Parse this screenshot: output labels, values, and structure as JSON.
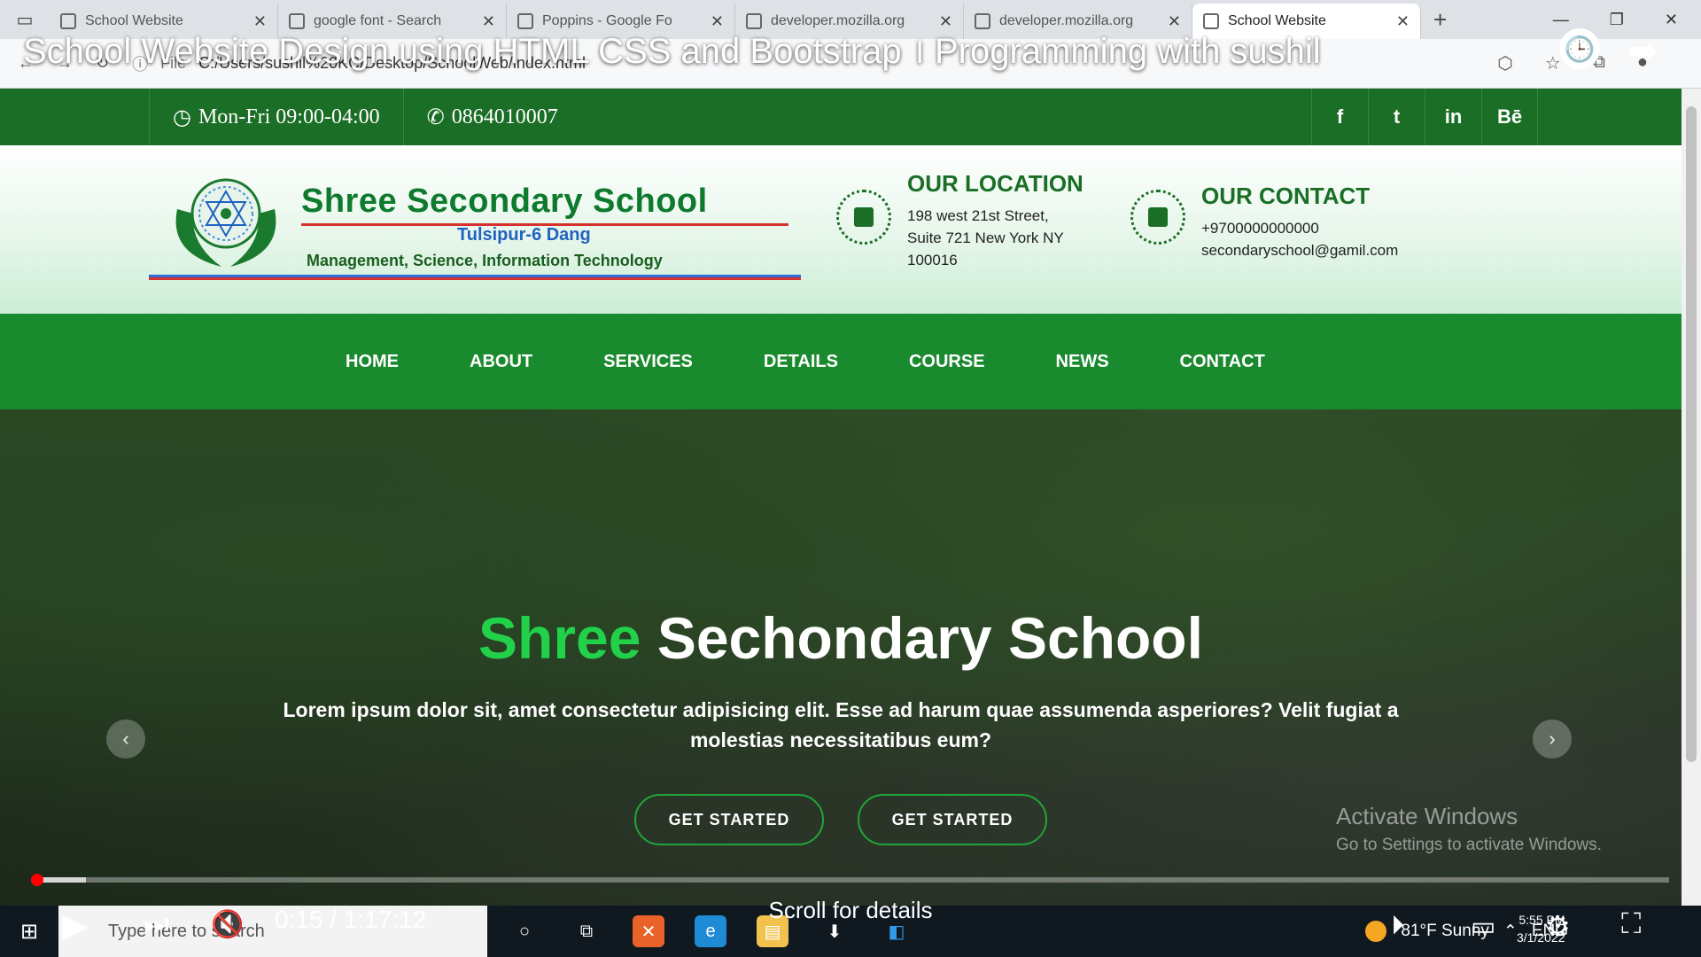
{
  "browser": {
    "tabs": [
      {
        "label": "School Website",
        "active": false
      },
      {
        "label": "google font - Search",
        "active": false
      },
      {
        "label": "Poppins - Google Fo",
        "active": false
      },
      {
        "label": "developer.mozilla.org",
        "active": false
      },
      {
        "label": "developer.mozilla.org",
        "active": false
      },
      {
        "label": "School Website",
        "active": true
      }
    ],
    "address_scheme": "File",
    "address": "C:/Users/sushil%20KC/Desktop/SchoolWeb/index.html"
  },
  "video": {
    "title": "School Website Design using HTML CSS and Bootstrap । Programming with sushil",
    "current_time": "0:15",
    "duration": "1:17:12",
    "time_display": "0:15 / 1:17:12",
    "progress_fraction": 0.0032,
    "buffered_fraction": 0.033,
    "scroll_hint": "Scroll for details"
  },
  "site": {
    "topbar": {
      "hours": "Mon-Fri 09:00-04:00",
      "phone": "0864010007",
      "socials": [
        "f",
        "t",
        "in",
        "Bē"
      ]
    },
    "logo": {
      "name": "Shree Secondary School",
      "place": "Tulsipur-6 Dang",
      "streams": "Management, Science, Information Technology"
    },
    "location": {
      "heading": "OUR LOCATION",
      "line1": "198 west 21st Street,",
      "line2": "Suite 721 New York NY",
      "line3": "100016"
    },
    "contact": {
      "heading": "OUR CONTACT",
      "phone": "+9700000000000",
      "email": "secondaryschool@gamil.com"
    },
    "nav": [
      "HOME",
      "ABOUT",
      "SERVICES",
      "DETAILS",
      "COURSE",
      "NEWS",
      "CONTACT"
    ],
    "hero": {
      "title_highlight": "Shree",
      "title_rest": "Sechondary School",
      "text": "Lorem ipsum dolor sit, amet consectetur adipisicing elit. Esse ad harum quae assumenda asperiores? Velit fugiat a molestias necessitatibus eum?",
      "button1": "GET STARTED",
      "button2": "GET STARTED",
      "watermark_title": "Activate Windows",
      "watermark_text": "Go to Settings to activate Windows."
    }
  },
  "taskbar": {
    "search_placeholder": "Type here to search",
    "weather": "81°F  Sunny",
    "lang": "ENG",
    "time": "5:55 PM",
    "date": "3/1/2022"
  },
  "colors": {
    "site_green": "#1a6e25",
    "nav_green": "#1a8a2e",
    "hero_accent": "#22d14a",
    "progress_red": "#ff0000"
  }
}
